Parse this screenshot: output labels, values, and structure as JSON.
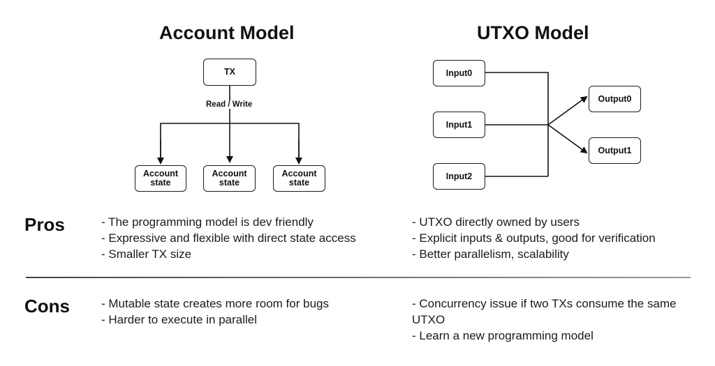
{
  "account_model": {
    "title": "Account Model",
    "tx_label": "TX",
    "edge_label": "Read / Write",
    "state_boxes": [
      "Account\nstate",
      "Account\nstate",
      "Account\nstate"
    ],
    "state_box_lines": [
      [
        "Account",
        "state"
      ],
      [
        "Account",
        "state"
      ],
      [
        "Account",
        "state"
      ]
    ]
  },
  "utxo_model": {
    "title": "UTXO Model",
    "inputs": [
      "Input0",
      "Input1",
      "Input2"
    ],
    "outputs": [
      "Output0",
      "Output1"
    ]
  },
  "pros": {
    "label": "Pros",
    "account": [
      "- The programming model is dev  friendly",
      "- Expressive and flexible with  direct state access",
      "- Smaller TX size"
    ],
    "utxo": [
      "- UTXO directly owned by users",
      "- Explicit inputs & outputs,  good for verification",
      "- Better parallelism,  scalability"
    ]
  },
  "cons": {
    "label": "Cons",
    "account": [
      "- Mutable state creates more  room for bugs",
      "- Harder to execute in parallel"
    ],
    "utxo": [
      "- Concurrency issue if two TXs  consume the same UTXO",
      "- Learn a new programming model"
    ]
  }
}
